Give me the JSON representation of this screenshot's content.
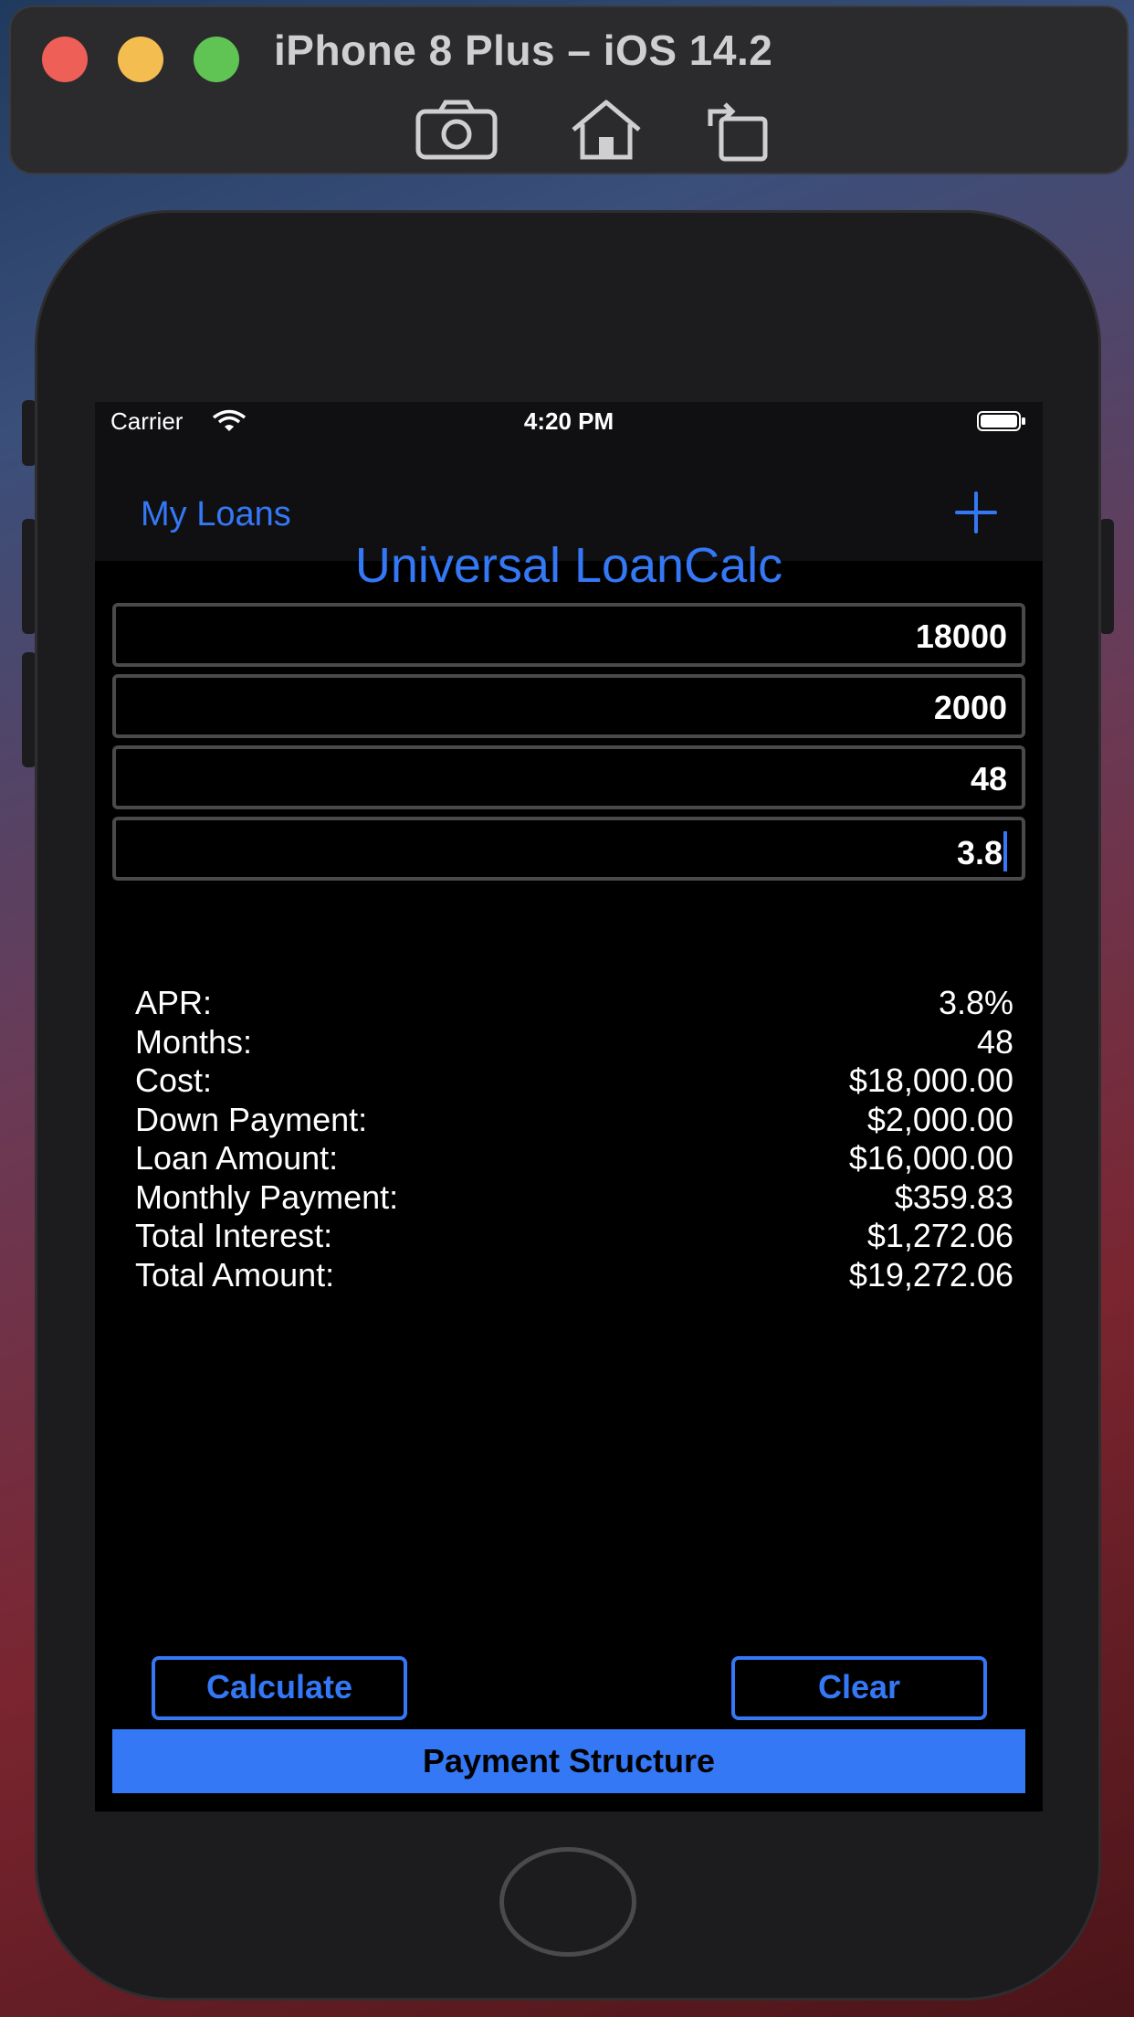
{
  "simulator": {
    "title": "iPhone 8 Plus – iOS 14.2",
    "tools": [
      "screenshot-icon",
      "home-icon",
      "rotate-icon"
    ]
  },
  "status_bar": {
    "carrier": "Carrier",
    "time": "4:20 PM"
  },
  "nav": {
    "back_label": "My Loans",
    "add_icon": "plus-icon"
  },
  "app": {
    "title": "Universal LoanCalc",
    "accent_color": "#3478f6"
  },
  "inputs": {
    "cost": "18000",
    "down_payment": "2000",
    "months": "48",
    "apr": "3.8"
  },
  "results": [
    {
      "label": "APR:",
      "value": "3.8%"
    },
    {
      "label": "Months:",
      "value": "48"
    },
    {
      "label": "Cost:",
      "value": "$18,000.00"
    },
    {
      "label": "Down Payment:",
      "value": "$2,000.00"
    },
    {
      "label": "Loan Amount:",
      "value": "$16,000.00"
    },
    {
      "label": "Monthly Payment:",
      "value": "$359.83"
    },
    {
      "label": "Total Interest:",
      "value": "$1,272.06"
    },
    {
      "label": "Total Amount:",
      "value": "$19,272.06"
    }
  ],
  "buttons": {
    "calculate": "Calculate",
    "clear": "Clear",
    "payment_structure": "Payment Structure"
  }
}
